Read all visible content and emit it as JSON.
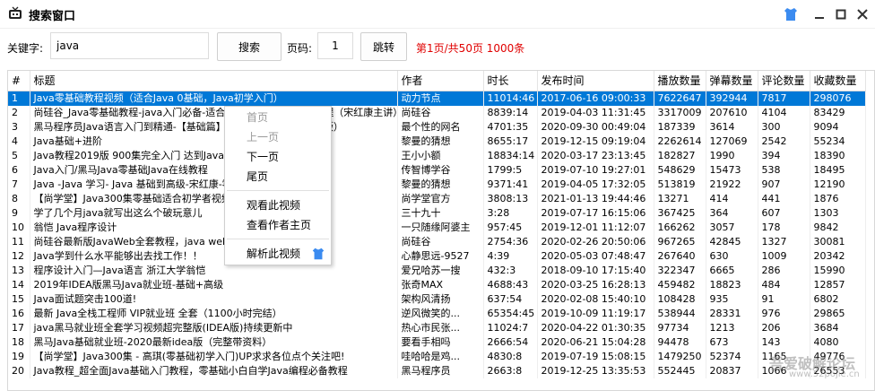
{
  "window": {
    "title": "搜索窗口"
  },
  "toolbar": {
    "keyword_label": "关键字:",
    "keyword_value": "java",
    "search_label": "搜索",
    "page_label": "页码:",
    "page_value": "1",
    "jump_label": "跳转",
    "page_info": "第1页/共50页 1000条"
  },
  "colors": {
    "selection": "#0078d7",
    "page_info": "#e00000",
    "skin_icon": "#3b8bf0"
  },
  "table": {
    "headers": [
      "#",
      "标题",
      "作者",
      "时长",
      "发布时间",
      "播放数量",
      "弹幕数量",
      "评论数量",
      "收藏数量"
    ],
    "rows": [
      [
        "1",
        "Java零基础教程视频（适合Java 0基础，Java初学入门）",
        "动力节点",
        "11014:46",
        "2017-06-16 09:00:33",
        "7622647",
        "392944",
        "7817",
        "298076"
      ],
      [
        "2",
        "尚硅谷_Java零基础教程-java入门必备-适合初学者的全套完整版教程（宋红康主讲）",
        "尚硅谷",
        "8839:14",
        "2019-04-03 11:31:45",
        "3317009",
        "207610",
        "4104",
        "83429"
      ],
      [
        "3",
        "黑马程序员Java语言入门到精通-【基础篇】2020全新版本（IDEA版）",
        "最个性的网名",
        "4701:35",
        "2020-09-30 00:49:04",
        "187339",
        "3614",
        "300",
        "9094"
      ],
      [
        "4",
        "Java基础+进阶",
        "黎曼的猜想",
        "8655:17",
        "2019-12-15 09:19:04",
        "2262614",
        "127069",
        "2542",
        "55234"
      ],
      [
        "5",
        "Java教程2019版 900集完全入门 达到Java中级工程师水平",
        "王小小额",
        "18834:14",
        "2020-03-17 23:13:45",
        "182827",
        "1990",
        "394",
        "18390"
      ],
      [
        "6",
        "Java入门/黑马Java零基础Java在线教程",
        "传智博学谷",
        "1799:5",
        "2019-07-10 19:27:01",
        "548629",
        "15473",
        "538",
        "18495"
      ],
      [
        "7",
        "Java -Java 学习- Java 基础到高级-宋红康-零基础自学Java-尚硅谷",
        "黎曼的猜想",
        "9371:41",
        "2019-04-05 17:32:05",
        "513819",
        "21922",
        "907",
        "12190"
      ],
      [
        "8",
        "【尚学堂】Java300集零基础适合初学者视频教程",
        "尚学堂官方",
        "3808:13",
        "2021-01-13 19:44:46",
        "13271",
        "414",
        "441",
        "1876"
      ],
      [
        "9",
        "学了几个月java就写出这么个破玩意儿",
        "三十九十",
        "3:28",
        "2019-07-17 16:15:06",
        "367425",
        "364",
        "607",
        "1303"
      ],
      [
        "10",
        "翁恺  Java程序设计",
        "一只随缘阿婆主",
        "957:45",
        "2019-12-01 11:12:07",
        "166262",
        "3057",
        "178",
        "9842"
      ],
      [
        "11",
        "尚硅谷最新版JavaWeb全套教程，java web零基础入门完整版",
        "尚硅谷",
        "2754:36",
        "2020-02-26 20:50:06",
        "967265",
        "42845",
        "1327",
        "30081"
      ],
      [
        "12",
        "Java学到什么水平能够出去找工作！！",
        "心静思远-9527",
        "4:39",
        "2020-05-03 07:48:47",
        "267640",
        "630",
        "1009",
        "20342"
      ],
      [
        "13",
        "程序设计入门—Java语言 浙江大学翁恺",
        "爱兄哈苏一搜",
        "432:3",
        "2018-09-10 17:15:40",
        "322347",
        "6665",
        "286",
        "15990"
      ],
      [
        "14",
        "2019年IDEA版黑马Java就业班-基础+高级",
        "张奇MAX",
        "4688:43",
        "2020-03-25 16:28:13",
        "459482",
        "18823",
        "484",
        "12857"
      ],
      [
        "15",
        "Java面试题突击100道!",
        "架构风清扬",
        "637:54",
        "2020-02-08 15:40:10",
        "108428",
        "935",
        "91",
        "6802"
      ],
      [
        "16",
        "最新 Java全栈工程师 VIP就业班 全套（1100小时完结）",
        "逆风微笑的...",
        "65354:45",
        "2019-10-09 11:19:17",
        "538944",
        "28331",
        "976",
        "29865"
      ],
      [
        "17",
        "java黑马就业班全套学习视频超完整版(IDEA版)持续更新中",
        "热心市民张...",
        "11024:7",
        "2020-04-22 01:30:35",
        "97734",
        "1213",
        "206",
        "3684"
      ],
      [
        "18",
        "黑马Java基础就业班-2020最新idea版（完整带资料）",
        "要看手相吗",
        "2666:54",
        "2020-06-21 15:04:28",
        "94478",
        "673",
        "143",
        "4080"
      ],
      [
        "19",
        "【尚学堂】Java300集 - 高琪(零基础初学入门)UP求求各位点个关注吧!",
        "哇哈哈是鸡...",
        "4830:8",
        "2019-07-19 15:08:15",
        "1479250",
        "52374",
        "1165",
        "49776"
      ],
      [
        "20",
        "Java教程_超全面Java基础入门教程，零基础小白自学Java编程必备教程",
        "黑马程序员",
        "2663:8",
        "2019-12-25 13:35:53",
        "552445",
        "20837",
        "1066",
        "26553"
      ]
    ]
  },
  "context_menu": {
    "items": [
      {
        "label": "首页",
        "enabled": false
      },
      {
        "label": "上一页",
        "enabled": false
      },
      {
        "label": "下一页",
        "enabled": true
      },
      {
        "label": "尾页",
        "enabled": true
      },
      {
        "label": "观看此视频",
        "enabled": true
      },
      {
        "label": "查看作者主页",
        "enabled": true
      },
      {
        "label": "解析此视频",
        "enabled": true
      }
    ]
  },
  "watermark": {
    "text": "吾爱破解论坛",
    "url": "www.52pojie.cn"
  }
}
